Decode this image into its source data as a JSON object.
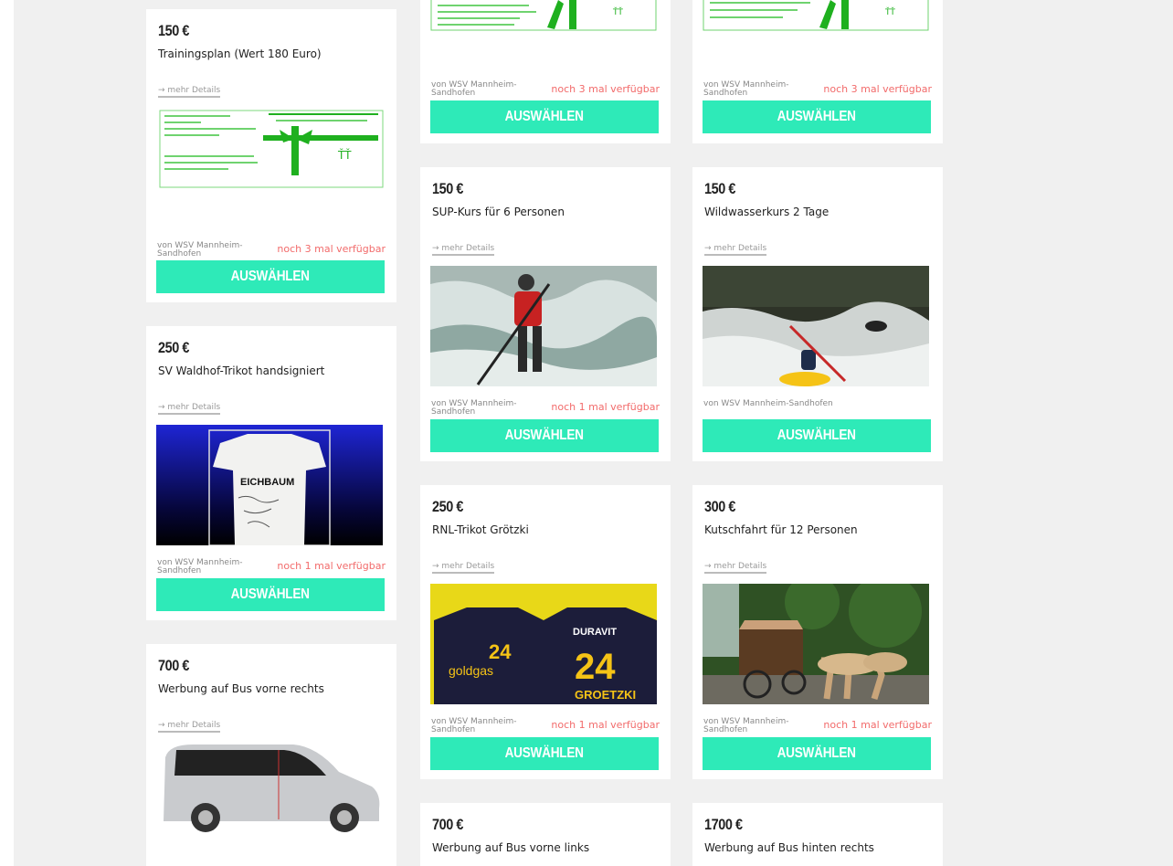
{
  "common": {
    "details_label": "→ mehr Details",
    "select_label": "AUSWÄHLEN"
  },
  "colors": {
    "accent": "#2eeab8",
    "availability": "#f26b6b",
    "background": "#f0f0f0"
  },
  "cards": {
    "top_mid": {
      "org": "von WSV Mannheim-Sandhofen",
      "availability": "noch 3 mal verfügbar"
    },
    "top_right": {
      "org": "von WSV Mannheim-Sandhofen",
      "availability": "noch 3 mal verfügbar"
    },
    "trainingsplan": {
      "price": "150 €",
      "title": "Trainingsplan (Wert 180 Euro)",
      "org": "von WSV Mannheim-Sandhofen",
      "availability": "noch 3 mal verfügbar",
      "image": "gift-voucher-image"
    },
    "sup": {
      "price": "150 €",
      "title": "SUP-Kurs für 6 Personen",
      "org": "von WSV Mannheim-Sandhofen",
      "availability": "noch 1 mal verfügbar",
      "image": "sup-photo"
    },
    "wildwasser": {
      "price": "150 €",
      "title": "Wildwasserkurs 2 Tage",
      "org": "von WSV Mannheim-Sandhofen",
      "availability": "",
      "image": "kayak-photo"
    },
    "waldhof": {
      "price": "250 €",
      "title": "SV Waldhof-Trikot handsigniert",
      "org": "von WSV Mannheim-Sandhofen",
      "availability": "noch 1 mal verfügbar",
      "image": "signed-jersey-photo"
    },
    "rnl": {
      "price": "250 €",
      "title": "RNL-Trikot Grötzki",
      "org": "von WSV Mannheim-Sandhofen",
      "availability": "noch 1 mal verfügbar",
      "image": "handball-jersey-photo",
      "jersey_texts": {
        "brand": "DURAVIT",
        "number": "24",
        "name": "GROETZKI",
        "sponsor": "goldgas"
      }
    },
    "kutsch": {
      "price": "300 €",
      "title": "Kutschfahrt für 12 Personen",
      "org": "von WSV Mannheim-Sandhofen",
      "availability": "noch 1 mal verfügbar",
      "image": "horse-carriage-photo"
    },
    "bus_vr": {
      "price": "700 €",
      "title": "Werbung auf Bus vorne rechts",
      "image": "van-photo"
    },
    "bus_vl": {
      "price": "700 €",
      "title": "Werbung auf Bus vorne links"
    },
    "bus_hr": {
      "price": "1700 €",
      "title": "Werbung auf Bus hinten rechts"
    }
  },
  "jersey_sponsor": "EICHBAUM"
}
